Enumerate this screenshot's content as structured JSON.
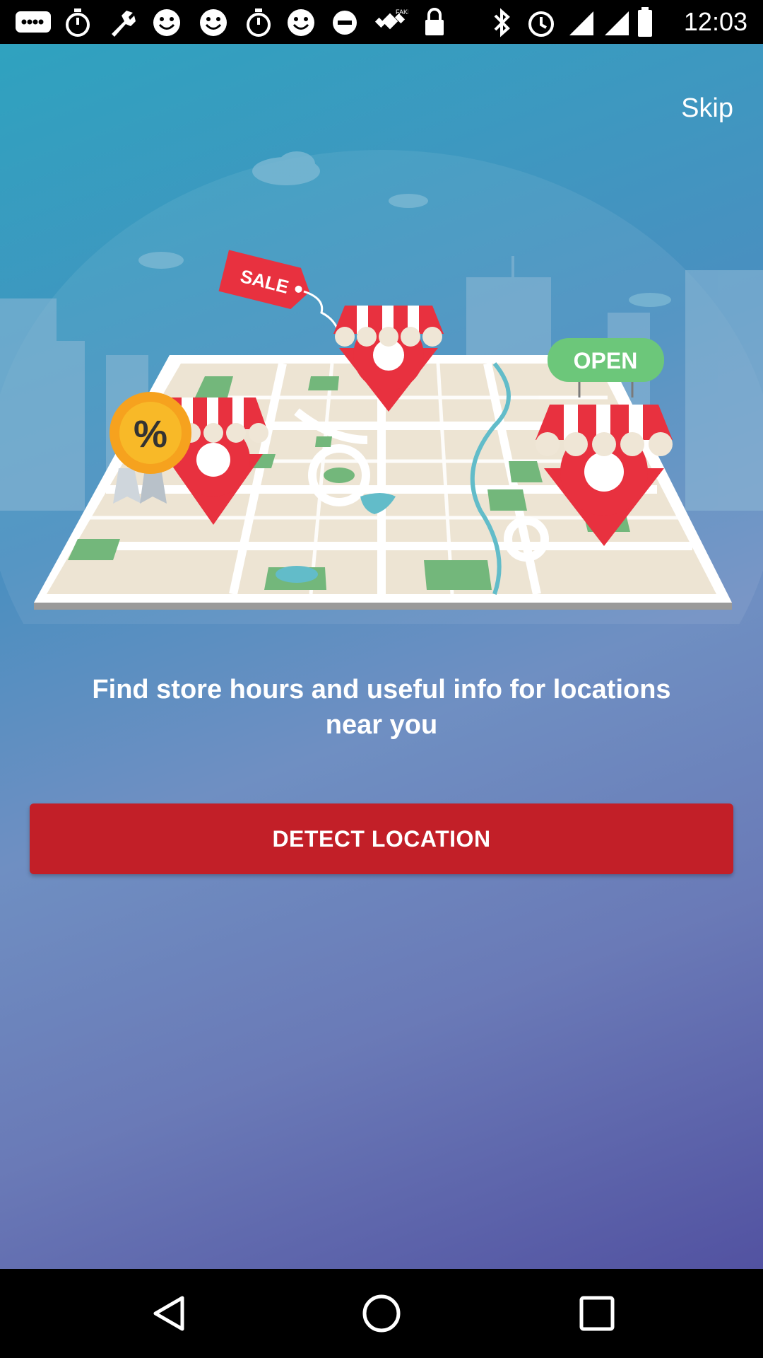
{
  "status_bar": {
    "time": "12:03",
    "left_icons": [
      "message-icon",
      "stopwatch-icon",
      "wrench-icon",
      "smiley-icon",
      "smiley-icon",
      "stopwatch-icon",
      "smiley-icon",
      "sync-icon",
      "satellite-icon",
      "lock-icon"
    ],
    "right_icons": [
      "bluetooth-icon",
      "alarm-icon",
      "signal-icon",
      "wifi-icon",
      "battery-icon"
    ]
  },
  "onboarding": {
    "skip_label": "Skip",
    "headline": "Find store hours and useful info for locations near you",
    "detect_button": "DETECT LOCATION",
    "illustration": {
      "sale_tag": "SALE",
      "open_sign": "OPEN",
      "badge_symbol": "%"
    }
  },
  "nav_bar": {
    "buttons": [
      "back-icon",
      "home-icon",
      "recents-icon"
    ]
  },
  "colors": {
    "accent": "#c21f28",
    "pin_red": "#e8313f",
    "background_top": "#2fa2bf",
    "background_bottom": "#5252a1",
    "open_green": "#6cc77a"
  }
}
